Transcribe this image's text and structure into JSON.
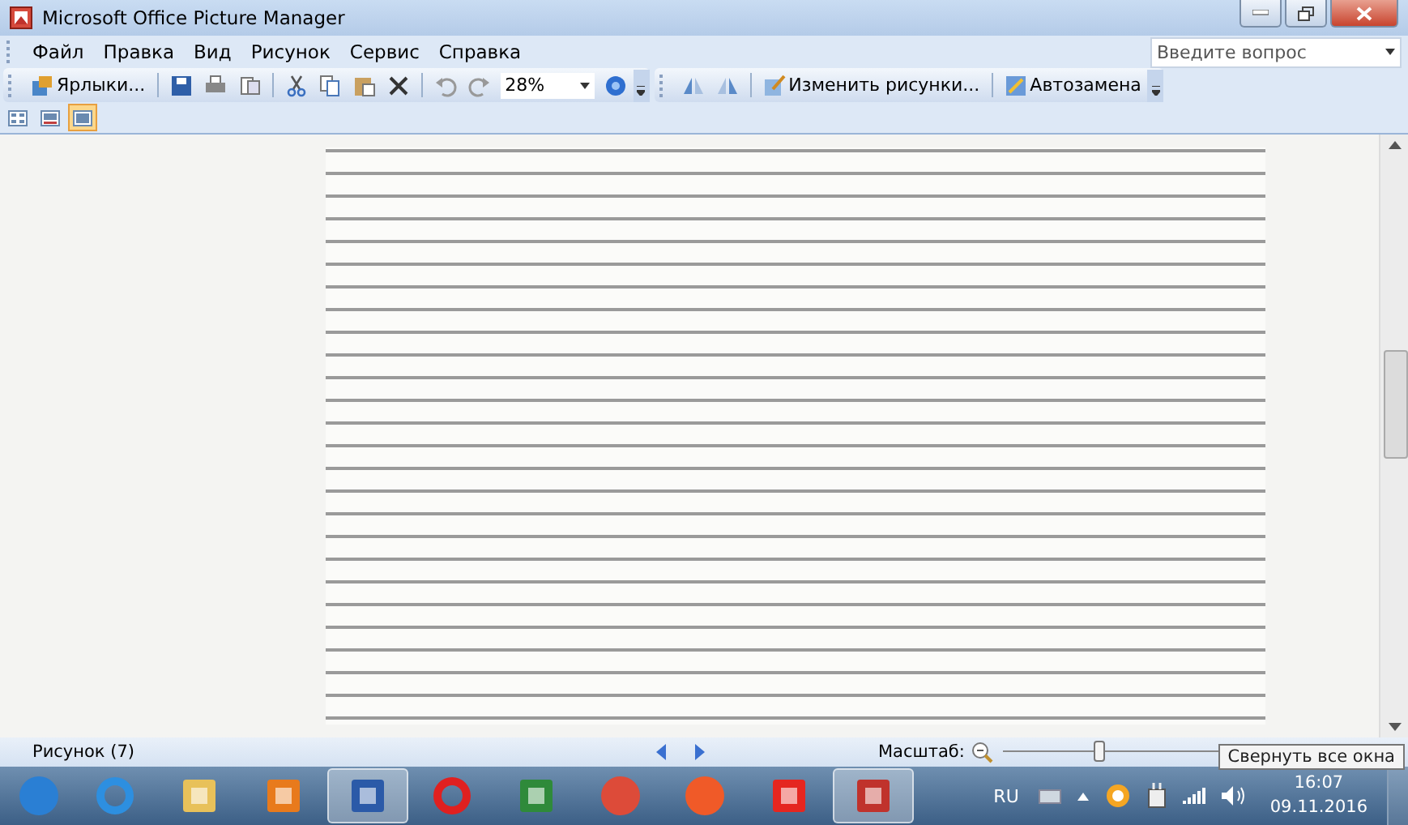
{
  "window": {
    "title": "Microsoft Office Picture Manager"
  },
  "menu": [
    "Файл",
    "Правка",
    "Вид",
    "Рисунок",
    "Сервис",
    "Справка"
  ],
  "help_search": {
    "placeholder": "Введите вопрос"
  },
  "toolbar": {
    "shortcuts_label": "Ярлыки...",
    "zoom_value": "28%",
    "edit_label": "Изменить рисунки...",
    "autocorrect_label": "Автозамена"
  },
  "view_buttons": [
    {
      "kind": "thumbnails",
      "selected": false
    },
    {
      "kind": "filmstrip",
      "selected": false
    },
    {
      "kind": "single",
      "selected": true
    }
  ],
  "status_bar": {
    "picture_label": "Рисунок (7)",
    "zoom_label": "Масштаб:",
    "zoom": {
      "level": 0.3
    }
  },
  "taskbar": {
    "apps": [
      {
        "kind": "start",
        "selected": false
      },
      {
        "kind": "ie",
        "selected": false
      },
      {
        "kind": "folder",
        "selected": false
      },
      {
        "kind": "media",
        "selected": false
      },
      {
        "kind": "word",
        "selected": true
      },
      {
        "kind": "opera",
        "selected": false
      },
      {
        "kind": "excel",
        "selected": false
      },
      {
        "kind": "chrome",
        "selected": false
      },
      {
        "kind": "video",
        "selected": false
      },
      {
        "kind": "yandex",
        "selected": false
      },
      {
        "kind": "picture",
        "selected": true
      }
    ],
    "language": "RU",
    "time": "16:07",
    "date": "09.11.2016"
  },
  "tooltip": {
    "text": "Свернуть все окна"
  }
}
